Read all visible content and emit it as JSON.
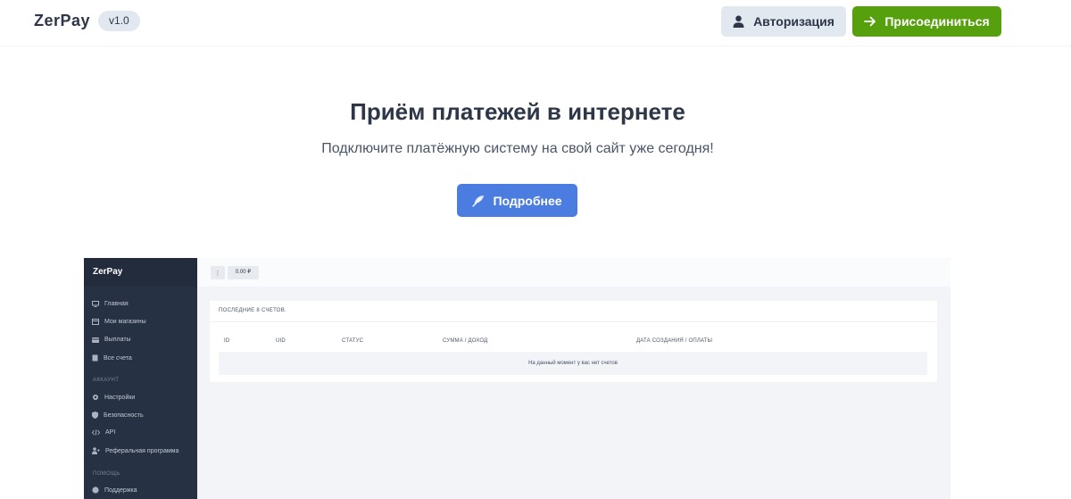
{
  "header": {
    "brand": "ZerPay",
    "version": "v1.0",
    "login_label": "Авторизация",
    "join_label": "Присоединиться"
  },
  "hero": {
    "title": "Приём платежей в интернете",
    "subtitle": "Подключите платёжную систему на свой сайт уже сегодня!",
    "more_label": "Подробнее"
  },
  "preview": {
    "logo": "ZerPay",
    "balance": "0.00 ₽",
    "menu_glyph": "⋮",
    "nav": [
      {
        "label": "Главная",
        "icon": "monitor-icon"
      },
      {
        "label": "Мои магазины",
        "icon": "store-icon"
      },
      {
        "label": "Выплаты",
        "icon": "card-icon"
      },
      {
        "label": "Все счета",
        "icon": "document-icon"
      }
    ],
    "section_account": "АККАУНТ",
    "account_nav": [
      {
        "label": "Настройки",
        "icon": "gear-icon"
      },
      {
        "label": "Безопасность",
        "icon": "shield-icon"
      },
      {
        "label": "API",
        "icon": "code-icon"
      },
      {
        "label": "Реферальная программа",
        "icon": "user-plus-icon"
      }
    ],
    "section_help": "ПОМОЩЬ",
    "help_nav": [
      {
        "label": "Поддержка",
        "icon": "support-icon"
      }
    ],
    "card_title": "ПОСЛЕДНИЕ 8 СЧЕТОВ.",
    "columns": [
      "ID",
      "UID",
      "СТАТУС",
      "СУММА / ДОХОД",
      "ДАТА СОЗДАНИЯ / ОПЛАТЫ"
    ],
    "empty_text": "На данный момент у вас нет счетов"
  },
  "colors": {
    "join_button": "#56a00d",
    "more_button": "#4b7de1",
    "sidebar": "#263143"
  }
}
